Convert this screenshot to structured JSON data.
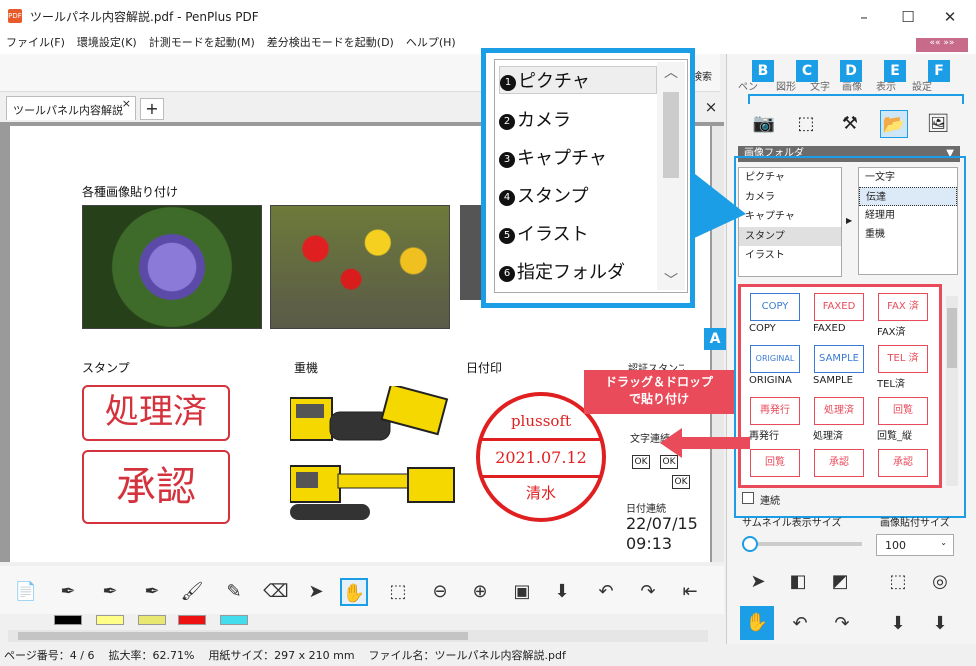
{
  "window": {
    "title": "ツールパネル内容解説.pdf - PenPlus PDF",
    "app_icon": "PDF"
  },
  "menu": [
    "ファイル(F)",
    "環境設定(K)",
    "計測モードを起動(M)",
    "差分検出モードを起動(D)",
    "ヘルプ(H)"
  ],
  "document_tab": {
    "label": "ツールパネル内容解説",
    "close": "×",
    "add": "+",
    "close_all": "×"
  },
  "page": {
    "heading_images": "各種画像貼り付け",
    "heading_stamp": "スタンプ",
    "heading_machine": "重機",
    "heading_date": "日付印",
    "heading_other": "認証スタンプ",
    "stamp1": "処理済",
    "stamp2": "承認",
    "date_stamp": {
      "top": "plussoft",
      "middle": "2021.07.12",
      "bottom": "清水"
    },
    "text_repeat_label": "文字連続",
    "ok": "OK",
    "date_repeat_label": "日付連続",
    "date_value": "22/07/15",
    "time_value": "09:13"
  },
  "popup": {
    "items": [
      "ピクチャ",
      "カメラ",
      "キャプチャ",
      "スタンプ",
      "イラスト",
      "指定フォルダ"
    ],
    "numbers": [
      "1",
      "2",
      "3",
      "4",
      "5",
      "6"
    ]
  },
  "callout": {
    "line1": "ドラッグ＆ドロップ",
    "line2": "で貼り付け"
  },
  "right_panel": {
    "tab_labels": [
      "ペン",
      "図形",
      "文字",
      "画像",
      "表示",
      "設定"
    ],
    "behind_label": "検索",
    "badges": [
      "B",
      "C",
      "D",
      "E",
      "F",
      "A"
    ],
    "folder_header": "画像フォルダ",
    "categories": [
      "ピクチャ",
      "カメラ",
      "キャプチャ",
      "スタンプ",
      "イラスト"
    ],
    "subfolders": [
      "一文字",
      "伝達",
      "経理用",
      "重機"
    ],
    "thumbs": [
      {
        "stamp": "COPY",
        "caption": "COPY"
      },
      {
        "stamp": "FAXED",
        "caption": "FAXED"
      },
      {
        "stamp": "FAX 済",
        "caption": "FAX済"
      },
      {
        "stamp": "ORIGINAL",
        "caption": "ORIGINA"
      },
      {
        "stamp": "SAMPLE",
        "caption": "SAMPLE"
      },
      {
        "stamp": "TEL 済",
        "caption": "TEL済"
      },
      {
        "stamp": "再発行",
        "caption": "再発行"
      },
      {
        "stamp": "処理済",
        "caption": "処理済"
      },
      {
        "stamp": "回覧",
        "caption": "回覧_縦"
      },
      {
        "stamp": "回覧",
        "caption": ""
      },
      {
        "stamp": "承認",
        "caption": ""
      },
      {
        "stamp": "承認",
        "caption": ""
      }
    ],
    "continuous_label": "連続",
    "thumb_size_label": "サムネイル表示サイズ",
    "paste_size_label": "画像貼付サイズ",
    "paste_size_value": "100"
  },
  "swatches": [
    "#000000",
    "#ffff88",
    "#e8e870",
    "#ee1111",
    "#44ddee"
  ],
  "status": {
    "page": "ページ番号：4 / 6",
    "zoom": "拡大率：62.71%",
    "paper": "用紙サイズ：297 x 210 mm",
    "file": "ファイル名：ツールパネル内容解説.pdf"
  }
}
